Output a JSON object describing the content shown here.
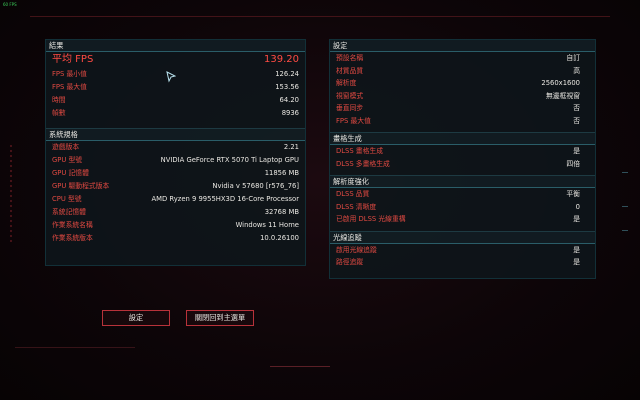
{
  "hud": {
    "fps_tag": "60 FPS"
  },
  "results": {
    "title": "結果",
    "avg_fps_label": "平均 FPS",
    "avg_fps_value": "139.20",
    "rows": [
      {
        "label": "FPS 最小值",
        "value": "126.24"
      },
      {
        "label": "FPS 最大值",
        "value": "153.56"
      },
      {
        "label": "時間",
        "value": "64.20"
      },
      {
        "label": "幀數",
        "value": "8936"
      }
    ]
  },
  "system": {
    "title": "系統規格",
    "rows": [
      {
        "label": "遊戲版本",
        "value": "2.21"
      },
      {
        "label": "GPU 型號",
        "value": "NVIDIA GeForce RTX 5070 Ti Laptop GPU"
      },
      {
        "label": "GPU 記憶體",
        "value": "11856 MB"
      },
      {
        "label": "GPU 驅動程式版本",
        "value": "Nvidia v 57680 [r576_76]"
      },
      {
        "label": "CPU 型號",
        "value": "AMD Ryzen 9 9955HX3D 16-Core Processor"
      },
      {
        "label": "系統記憶體",
        "value": "32768 MB"
      },
      {
        "label": "作業系統名稱",
        "value": "Windows 11 Home"
      },
      {
        "label": "作業系統版本",
        "value": "10.0.26100"
      }
    ]
  },
  "settings": {
    "title": "設定",
    "rows": [
      {
        "label": "預設名稱",
        "value": "自訂"
      },
      {
        "label": "材質品質",
        "value": "高"
      },
      {
        "label": "解析度",
        "value": "2560x1600"
      },
      {
        "label": "視窗模式",
        "value": "無邊框視窗"
      },
      {
        "label": "垂直同步",
        "value": "否"
      },
      {
        "label": "FPS 最大值",
        "value": "否"
      }
    ]
  },
  "framegen": {
    "title": "畫格生成",
    "rows": [
      {
        "label": "DLSS 畫格生成",
        "value": "是"
      },
      {
        "label": "DLSS 多畫格生成",
        "value": "四倍"
      }
    ]
  },
  "upscaling": {
    "title": "解析度強化",
    "rows": [
      {
        "label": "DLSS 品質",
        "value": "平衡"
      },
      {
        "label": "DLSS 清晰度",
        "value": "0"
      },
      {
        "label": "已啟用 DLSS 光線重構",
        "value": "是"
      }
    ]
  },
  "raytracing": {
    "title": "光線追蹤",
    "rows": [
      {
        "label": "啟用光線追蹤",
        "value": "是"
      },
      {
        "label": "路徑追蹤",
        "value": "是"
      }
    ]
  },
  "buttons": {
    "settings_label": "設定",
    "close_label": "關閉回到主選單"
  }
}
